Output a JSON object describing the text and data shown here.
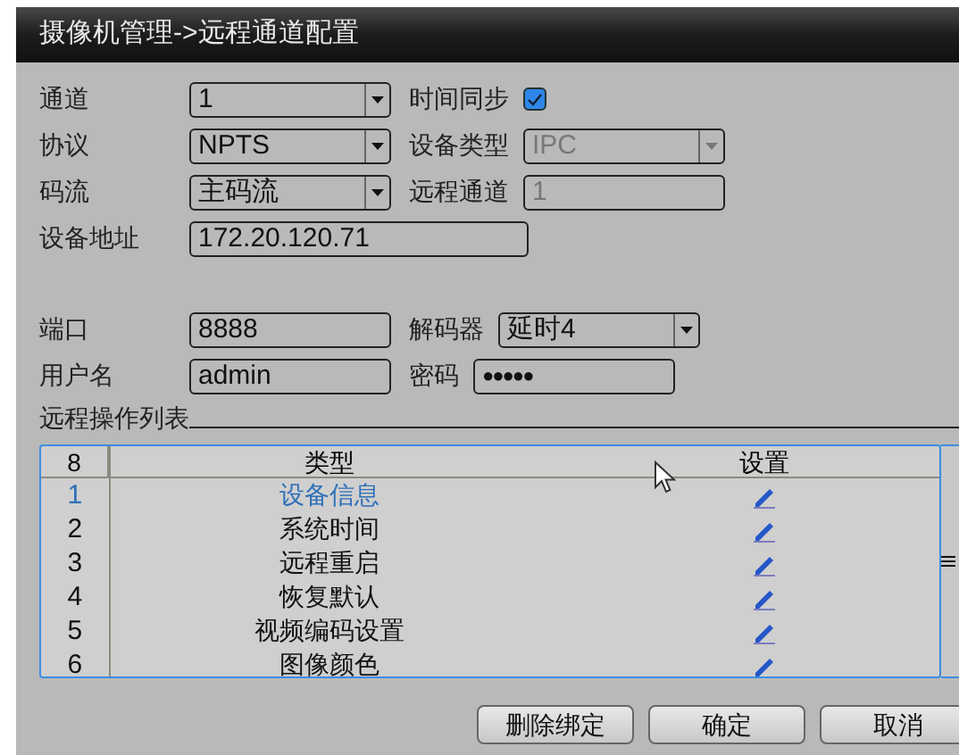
{
  "window": {
    "title": "摄像机管理->远程通道配置"
  },
  "form_groups": [
    [
      [
        {
          "label": "通道",
          "kind": "select",
          "value": "1",
          "disabled": false
        },
        {
          "label": "时间同步",
          "kind": "checkbox",
          "checked": true
        }
      ],
      [
        {
          "label": "协议",
          "kind": "select",
          "value": "NPTS",
          "disabled": false
        },
        {
          "label": "设备类型",
          "kind": "select",
          "value": "IPC",
          "disabled": true
        }
      ],
      [
        {
          "label": "码流",
          "kind": "select",
          "value": "主码流",
          "disabled": false
        },
        {
          "label": "远程通道",
          "kind": "input",
          "value": "1",
          "disabled": true
        }
      ],
      [
        {
          "label": "设备地址",
          "kind": "wide_input",
          "value": "172.20.120.71",
          "disabled": false
        }
      ]
    ],
    [
      [
        {
          "label": "端口",
          "kind": "input",
          "value": "8888",
          "disabled": false
        },
        {
          "label": "解码器",
          "kind": "select",
          "value": "延时4",
          "disabled": false
        }
      ],
      [
        {
          "label": "用户名",
          "kind": "input",
          "value": "admin",
          "disabled": false
        },
        {
          "label": "密码",
          "kind": "password",
          "value": "●●●●●",
          "disabled": false
        }
      ]
    ]
  ],
  "table": {
    "title": "远程操作列表",
    "columns": [
      "8",
      "类型",
      "设置"
    ],
    "rows": [
      {
        "number": "1",
        "type": "设备信息",
        "selected": true
      },
      {
        "number": "2",
        "type": "系统时间",
        "selected": false
      },
      {
        "number": "3",
        "type": "远程重启",
        "selected": false
      },
      {
        "number": "4",
        "type": "恢复默认",
        "selected": false
      },
      {
        "number": "5",
        "type": "视频编码设置",
        "selected": false
      },
      {
        "number": "6",
        "type": "图像颜色",
        "selected": false
      }
    ]
  },
  "buttons": [
    "删除绑定",
    "确定",
    "取消"
  ]
}
